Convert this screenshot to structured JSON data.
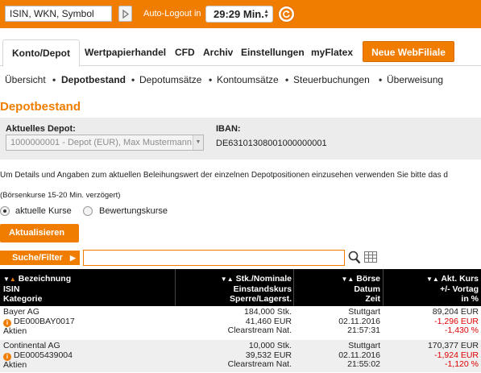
{
  "topbar": {
    "search_value": "ISIN, WKN, Symbol",
    "logout_label": "Auto-Logout in",
    "timer": "29:29 Min.",
    "accent": "#f07d00"
  },
  "tabs": [
    "Konto/Depot",
    "Wertpapierhandel",
    "CFD",
    "Archiv",
    "Einstellungen",
    "myFlatex"
  ],
  "webfiliale_label": "Neue WebFiliale",
  "subnav": [
    "Übersicht",
    "Depotbestand",
    "Depotumsätze",
    "Kontoumsätze",
    "Steuerbuchungen",
    "Überweisung"
  ],
  "page_title": "Depotbestand",
  "depot": {
    "depot_label": "Aktuelles Depot:",
    "depot_value": "1000000001 - Depot (EUR), Max Mustermann",
    "iban_label": "IBAN:",
    "iban_value": "DE63101308001000000001"
  },
  "info_text": "Um Details und Angaben zum aktuellen Beleihungswert der einzelnen Depotpositionen einzusehen verwenden Sie bitte das d",
  "delay_text": "(Börsenkurse 15-20 Min. verzögert)",
  "radio": {
    "option1": "aktuelle Kurse",
    "option2": "Bewertungskurse"
  },
  "update_button": "Aktualisieren",
  "filter_button": "Suche/Filter",
  "table": {
    "headers": {
      "col1": [
        "Bezeichnung",
        "ISIN",
        "Kategorie"
      ],
      "col2": [
        "Stk./Nominale",
        "Einstandskurs",
        "Sperre/Lagerst."
      ],
      "col3": [
        "Börse",
        "Datum",
        "Zeit"
      ],
      "col4": [
        "Akt. Kurs",
        "+/- Vortag",
        "in %"
      ]
    },
    "rows": [
      {
        "name": "Bayer AG",
        "isin": "DE000BAY0017",
        "category": "Aktien",
        "qty": "184,000 Stk.",
        "cost": "41,460 EUR",
        "lager": "Clearstream Nat.",
        "exchange": "Stuttgart",
        "date": "02.11.2016",
        "time": "21:57:31",
        "price": "89,204 EUR",
        "change": "-1,296 EUR",
        "pct": "-1,430 %"
      },
      {
        "name": "Continental AG",
        "isin": "DE0005439004",
        "category": "Aktien",
        "qty": "10,000 Stk.",
        "cost": "39,532 EUR",
        "lager": "Clearstream Nat.",
        "exchange": "Stuttgart",
        "date": "02.11.2016",
        "time": "21:55:02",
        "price": "170,377 EUR",
        "change": "-1,924 EUR",
        "pct": "-1,120 %"
      }
    ]
  }
}
